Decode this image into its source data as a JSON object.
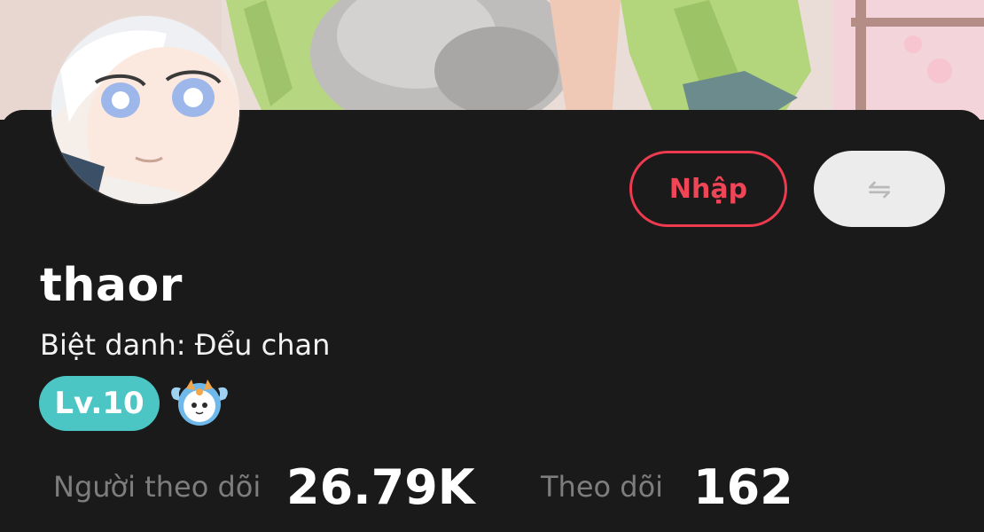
{
  "profile": {
    "username": "thaor",
    "nickname_line": "Biệt danh: Đểu chan",
    "level_badge": "Lv.10"
  },
  "actions": {
    "enter_label": "Nhập",
    "switch_icon_glyph": "⇋"
  },
  "stats": {
    "followers_label": "Người theo dõi",
    "followers_value": "26.79K",
    "following_label": "Theo dõi",
    "following_value": "162"
  },
  "colors": {
    "background": "#1a1a1a",
    "accent_red": "#ee3a4f",
    "level_teal": "#4cc6c4",
    "muted_text": "#7d7d7d"
  },
  "icons": {
    "switch": "swap-arrows-icon",
    "mascot": "mascot-badge-icon"
  }
}
